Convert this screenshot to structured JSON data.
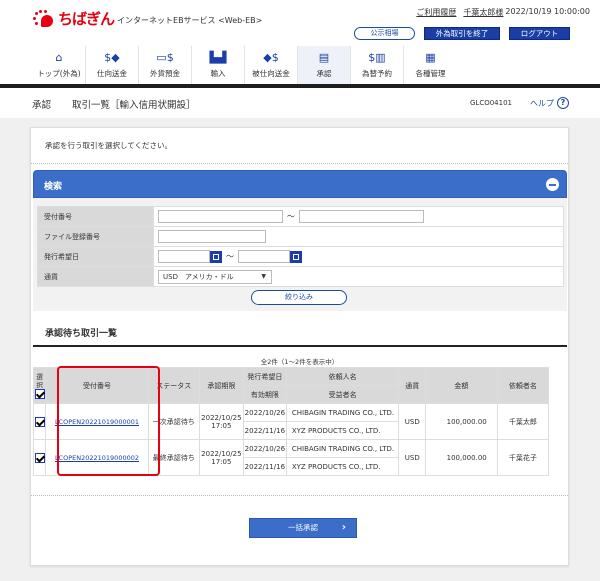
{
  "header": {
    "logo_text": "ちばぎん",
    "service_name": "インターネットEBサービス <Web-EB>",
    "usage_history_link": "ご利用履歴",
    "user_name": "千葉太郎様",
    "datetime": "2022/10/19 10:00:00",
    "buttons": {
      "rates": "公示相場",
      "end_fx": "外為取引を終了",
      "logout": "ログアウト"
    }
  },
  "nav": {
    "items": [
      {
        "label": "トップ(外為)",
        "icon": "home-icon"
      },
      {
        "label": "仕向送金",
        "icon": "remittance-icon"
      },
      {
        "label": "外貨預金",
        "icon": "deposit-icon"
      },
      {
        "label": "輸入",
        "icon": "import-icon"
      },
      {
        "label": "被仕向送金",
        "icon": "incoming-remittance-icon"
      },
      {
        "label": "承認",
        "icon": "approval-icon",
        "active": true
      },
      {
        "label": "為替予約",
        "icon": "fx-contract-icon"
      },
      {
        "label": "各種管理",
        "icon": "management-icon"
      }
    ]
  },
  "titlebar": {
    "section": "承認",
    "title": "取引一覧［輸入信用状開設］",
    "screen_code": "GLCO04101",
    "help": "ヘルプ",
    "help_icon": "?"
  },
  "instruction": "承認を行う取引を選択してください。",
  "search": {
    "title": "検索",
    "fields": {
      "receipt_no": {
        "label": "受付番号",
        "from": "",
        "to": "",
        "sep": "～"
      },
      "file_no": {
        "label": "ファイル登録番号",
        "value": ""
      },
      "issue_date": {
        "label": "発行希望日",
        "from": "",
        "to": "",
        "sep": "～"
      },
      "currency": {
        "label": "通貨",
        "value": "USD　アメリカ・ドル",
        "arrow": "▼"
      }
    },
    "filter_button": "絞り込み"
  },
  "list": {
    "title": "承認待ち取引一覧",
    "count_text": "全2件（1～2件を表示中）",
    "headers": {
      "select": "選択",
      "receipt_no": "受付番号",
      "status": "ステータス",
      "deadline": "承認期限",
      "issue_date": "発行希望日",
      "expiry": "有効期限",
      "applicant": "依頼人名",
      "beneficiary": "受益者名",
      "currency": "通貨",
      "amount": "金額",
      "requester": "依頼者名"
    },
    "rows": [
      {
        "selected": true,
        "receipt_no": "LCOPEN20221019000001",
        "status": "一次承認待ち",
        "deadline_date": "2022/10/25",
        "deadline_time": "17:05",
        "issue_date": "2022/10/26",
        "expiry": "2022/11/16",
        "applicant": "CHIBAGIN TRADING CO., LTD.",
        "beneficiary": "XYZ PRODUCTS CO., LTD.",
        "currency": "USD",
        "amount": "100,000.00",
        "requester": "千葉太郎"
      },
      {
        "selected": true,
        "receipt_no": "LCOPEN20221019000002",
        "status": "最終承認待ち",
        "deadline_date": "2022/10/25",
        "deadline_time": "17:05",
        "issue_date": "2022/10/26",
        "expiry": "2022/11/16",
        "applicant": "CHIBAGIN TRADING CO., LTD.",
        "beneficiary": "XYZ PRODUCTS CO., LTD.",
        "currency": "USD",
        "amount": "100,000.00",
        "requester": "千葉花子"
      }
    ]
  },
  "bulk_approve_button": "一括承認",
  "bulk_approve_chevron": "›",
  "colors": {
    "brand_red": "#e60012",
    "primary_blue": "#1a3ea6",
    "panel_blue": "#3a6ec8"
  }
}
